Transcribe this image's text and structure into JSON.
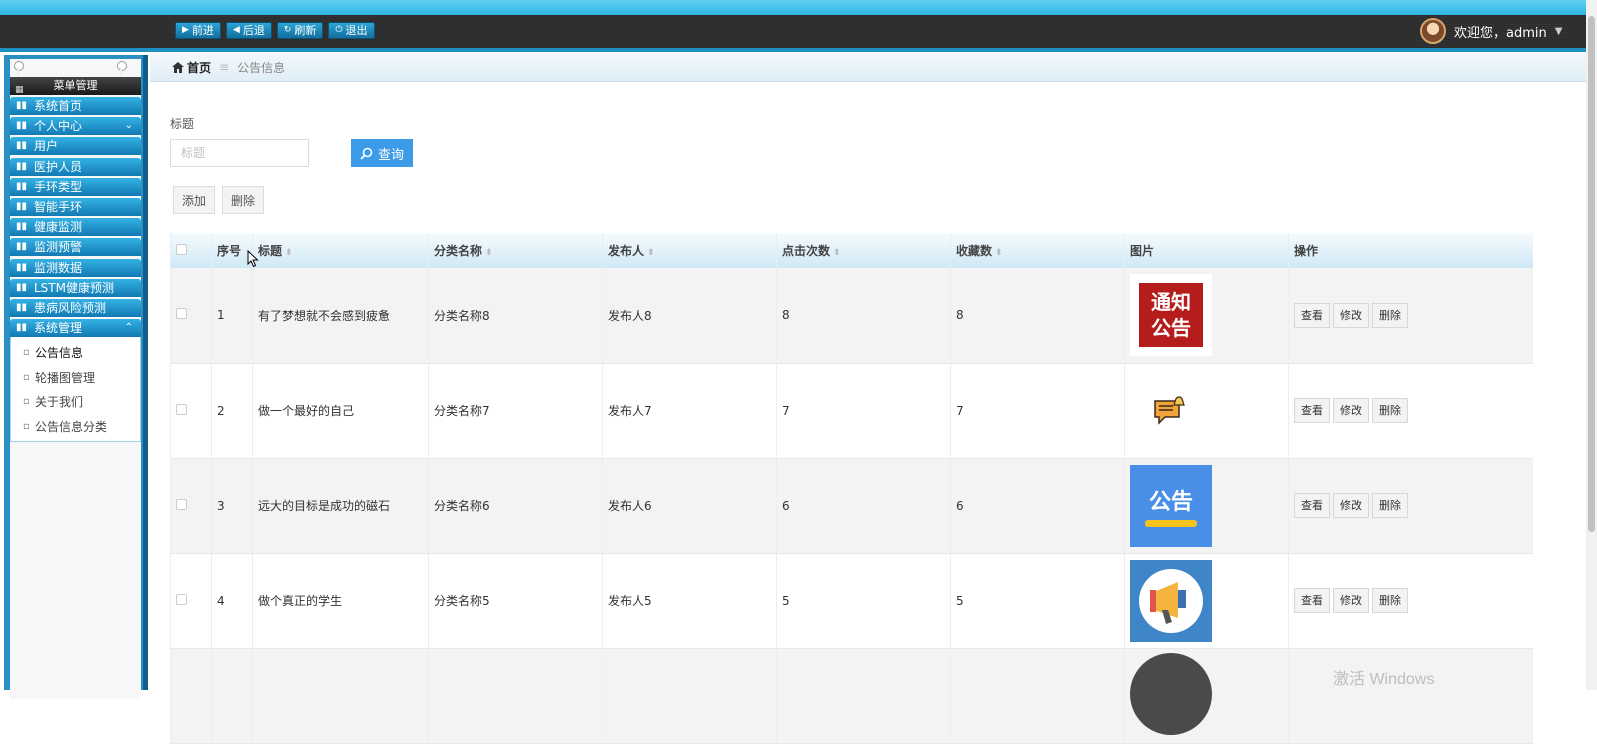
{
  "toolbar": {
    "buttons": [
      {
        "icon": "play-icon",
        "glyph": "▶",
        "label": "前进"
      },
      {
        "icon": "back-icon",
        "glyph": "◀",
        "label": "后退"
      },
      {
        "icon": "refresh-icon",
        "glyph": "↻",
        "label": "刷新"
      },
      {
        "icon": "power-icon",
        "glyph": "⏻",
        "label": "退出"
      }
    ]
  },
  "user": {
    "greeting": "欢迎您，admin",
    "caret": "▼"
  },
  "sidebar": {
    "header": "菜单管理",
    "items": [
      {
        "label": "系统首页",
        "chevron": ""
      },
      {
        "label": "个人中心",
        "chevron": "⌄"
      },
      {
        "label": "用户",
        "chevron": ""
      },
      {
        "label": "医护人员",
        "chevron": ""
      },
      {
        "label": "手环类型",
        "chevron": ""
      },
      {
        "label": "智能手环",
        "chevron": ""
      },
      {
        "label": "健康监测",
        "chevron": ""
      },
      {
        "label": "监测预警",
        "chevron": ""
      },
      {
        "label": "监测数据",
        "chevron": ""
      },
      {
        "label": "LSTM健康预测",
        "chevron": ""
      },
      {
        "label": "患病风险预测",
        "chevron": ""
      },
      {
        "label": "系统管理",
        "chevron": "⌃"
      }
    ],
    "subitems": [
      {
        "label": "公告信息",
        "active": true
      },
      {
        "label": "轮播图管理",
        "active": false
      },
      {
        "label": "关于我们",
        "active": false
      },
      {
        "label": "公告信息分类",
        "active": false
      }
    ]
  },
  "breadcrumb": {
    "home": "首页",
    "sep": "≡",
    "current": "公告信息"
  },
  "search": {
    "label": "标题",
    "placeholder": "标题",
    "query_label": "查询"
  },
  "actions": {
    "add": "添加",
    "delete": "删除"
  },
  "table": {
    "headers": {
      "index": "序号",
      "title": "标题",
      "category": "分类名称",
      "publisher": "发布人",
      "clicks": "点击次数",
      "favorites": "收藏数",
      "image": "图片",
      "ops": "操作"
    },
    "op_labels": {
      "view": "查看",
      "edit": "修改",
      "delete": "删除"
    },
    "rows": [
      {
        "index": "1",
        "title": "有了梦想就不会感到疲惫",
        "category": "分类名称8",
        "publisher": "发布人8",
        "clicks": "8",
        "favorites": "8",
        "image_text1": "通知",
        "image_text2": "公告"
      },
      {
        "index": "2",
        "title": "做一个最好的自己",
        "category": "分类名称7",
        "publisher": "发布人7",
        "clicks": "7",
        "favorites": "7"
      },
      {
        "index": "3",
        "title": "远大的目标是成功的磁石",
        "category": "分类名称6",
        "publisher": "发布人6",
        "clicks": "6",
        "favorites": "6",
        "image_text1": "公告"
      },
      {
        "index": "4",
        "title": "做个真正的学生",
        "category": "分类名称5",
        "publisher": "发布人5",
        "clicks": "5",
        "favorites": "5"
      }
    ]
  },
  "watermark": "激活 Windows",
  "colors": {
    "accent": "#3c9be8",
    "sidebar": "#1279b3",
    "topbar": "#2b2b2b"
  }
}
